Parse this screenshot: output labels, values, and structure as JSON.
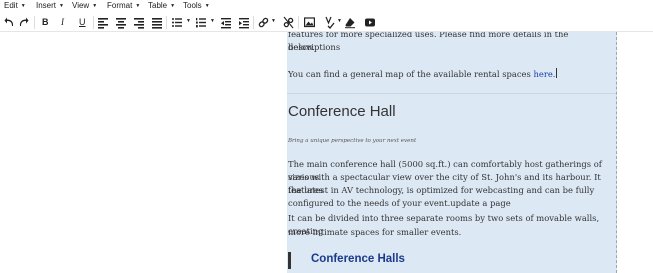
{
  "menubar": {
    "items": [
      {
        "label": "Edit"
      },
      {
        "label": "Insert"
      },
      {
        "label": "View"
      },
      {
        "label": "Format"
      },
      {
        "label": "Table"
      },
      {
        "label": "Tools"
      }
    ]
  },
  "toolbar": {
    "buttons": [
      "undo-icon",
      "redo-icon",
      "bold-icon",
      "italic-icon",
      "underline-icon",
      "align-left-icon",
      "align-center-icon",
      "align-right-icon",
      "align-justify-icon",
      "bullet-list-icon",
      "numbered-list-icon",
      "outdent-icon",
      "indent-icon",
      "link-icon",
      "unlink-icon",
      "image-icon",
      "spellcheck-icon",
      "eraser-icon",
      "video-icon"
    ],
    "bold_label": "B",
    "italic_label": "I",
    "underline_label": "U"
  },
  "editor": {
    "para1_line1": "features for more specialized uses. Please find more details in the descriptions",
    "para1_line2": "below.",
    "para2_text": "You can find a general map of the available rental spaces ",
    "para2_link": "here.",
    "heading": "Conference Hall",
    "tagline": "Bring a unique perspective to your next event",
    "body_lines": [
      "The main conference hall (5000 sq.ft.) can comfortably host gatherings of various",
      "sizes with a spectacular view over the city of St. John's and its harbour. It features",
      "the latest in AV technology, is optimized for webcasting and can be fully",
      "configured to the needs of your event.update a page",
      "It can be divided into three separate rooms by two sets of movable walls, creating",
      "more intimate spaces for smaller events."
    ],
    "subheading": "Conference Halls"
  },
  "colors": {
    "editor_bg": "#dce8f4",
    "link": "#1a3ea8",
    "subheading": "#1b3a8c"
  }
}
